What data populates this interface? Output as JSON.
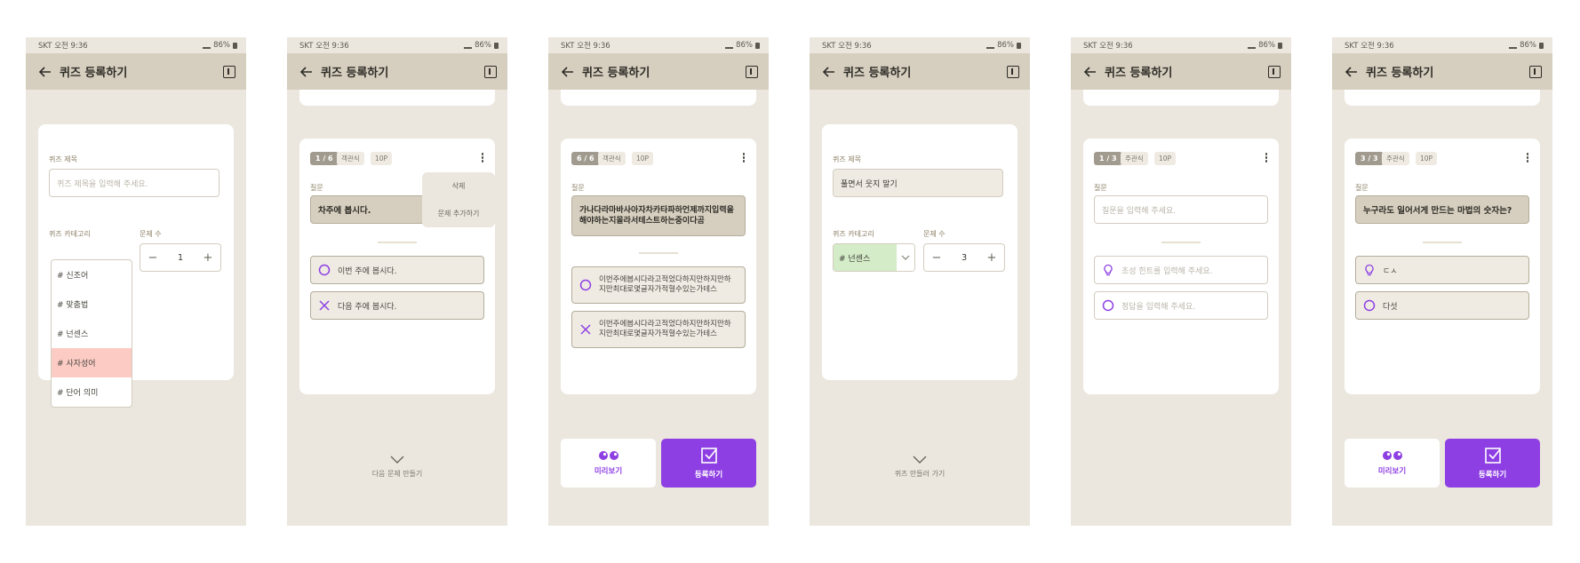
{
  "status": {
    "carrier": "SKT",
    "time": "오전 9:36",
    "battery": "86%"
  },
  "appbar": {
    "title": "퀴즈 등록하기"
  },
  "labels": {
    "quiz_title": "퀴즈 제목",
    "quiz_category": "퀴즈 카테고리",
    "question_count": "문제 수",
    "question": "질문"
  },
  "screen1": {
    "title_placeholder": "퀴즈 제목을 입력해 주세요.",
    "count": "1",
    "categories": [
      "# 신조어",
      "# 맞춤법",
      "# 넌센스",
      "# 사자성어",
      "# 단어 의미"
    ],
    "selected_category": "# 사자성어"
  },
  "screen2": {
    "progress": "1 / 6",
    "type": "객관식",
    "points": "10P",
    "question": "차주에 봅시다.",
    "menu": [
      "삭제",
      "문제 추가하기"
    ],
    "answers": [
      "이번 주에 봅시다.",
      "다음 주에 봅시다."
    ],
    "next_label": "다음 문제 만들기"
  },
  "screen3": {
    "progress": "6 / 6",
    "type": "객관식",
    "points": "10P",
    "question": "가나다라마바사아자차카타파하언제까지입력을해야하는지몰라서테스트하는중이다곰",
    "answers": [
      "이번주에봅시다라고적었다하지만하지만하지만최대로몇글자가적혈수있는가테스",
      "이번주에봅시다라고적었다하지만하지만하지만최대로몇글자가적혈수있는가테스"
    ],
    "preview_label": "미리보기",
    "submit_label": "등록하기"
  },
  "screen4": {
    "title_value": "풀면서 웃지 말기",
    "category_value": "# 넌센스",
    "count": "3",
    "back_label": "퀴즈 만들러 가기"
  },
  "screen5": {
    "progress": "1 / 3",
    "type": "주관식",
    "points": "10P",
    "question_placeholder": "질문을 입력해 주세요.",
    "hint_placeholder": "초성 힌트를 입력해 주세요.",
    "answer_placeholder": "정답을 입력해 주세요."
  },
  "screen6": {
    "progress": "3 / 3",
    "type": "주관식",
    "points": "10P",
    "question": "누구라도 일어서게 만드는 마법의 숫자는?",
    "hint": "ㄷㅅ",
    "answer": "다섯",
    "preview_label": "미리보기",
    "submit_label": "등록하기"
  },
  "colors": {
    "background": "#ece7de",
    "appbar": "#d6cfbf",
    "accent": "#8e3fe3",
    "selected_category": "#fbcbc4",
    "category_chip": "#d4ecc8"
  }
}
